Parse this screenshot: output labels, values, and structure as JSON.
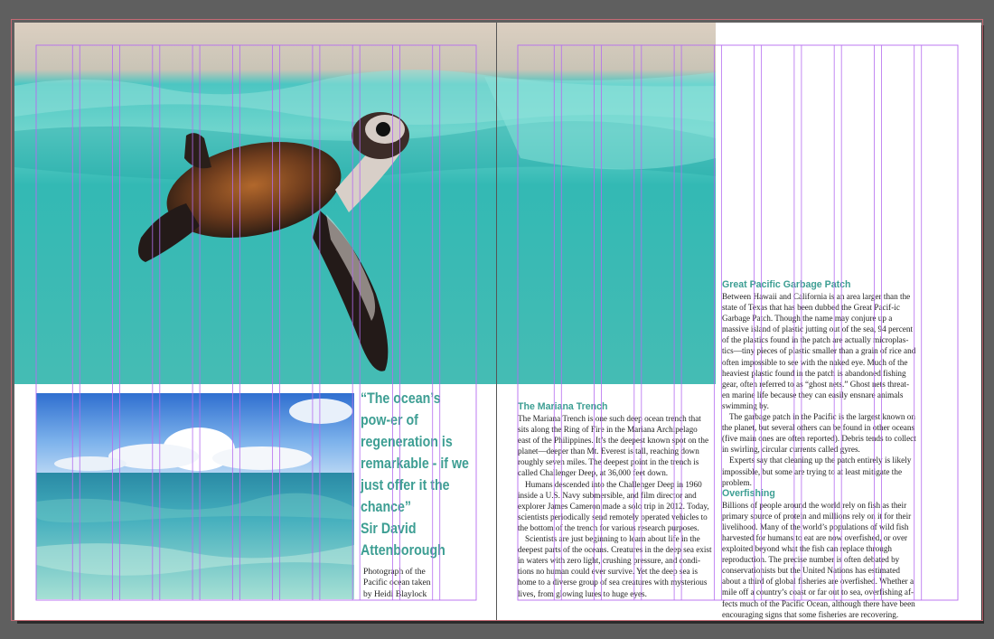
{
  "colors": {
    "accent": "#3d9e93",
    "guide": "#b56cf0",
    "pasteboard": "#5f5f5f",
    "bleed": "#c66a74"
  },
  "images": {
    "turtle": "sea-turtle-photo",
    "ocean": "pacific-ocean-photo"
  },
  "quote": {
    "text": "“The ocean’s pow-er of regeneration is remarkable - if we just offer it the chance”",
    "attribution": "Sir David Attenborough"
  },
  "caption": {
    "lines": [
      "Photograph of the",
      "Pacific ocean taken",
      "by Heidi Blaylock"
    ]
  },
  "mariana": {
    "heading": "The Mariana Trench",
    "paragraphs": [
      "The Mariana Trench is one such deep ocean trench that sits along the Ring of Fire in the Mariana Archipelago east of the Philippines. It’s the deepest known spot on the planet—deeper than Mt. Everest is tall, reaching down roughly seven miles. The deepest point in the trench is called Challenger Deep, at 36,000 feet down.",
      "Humans descended into the Challenger Deep in 1960 inside a U.S. Navy submersible, and film director and explorer James Cameron made a solo trip in 2012. Today, scientists periodically send remotely operated vehicles to the bottom of the trench for various research purposes.",
      "Scientists are just beginning to learn about life in the deepest parts of the oceans. Creatures in the deep sea exist in waters with zero light, crushing pressure, and condi-tions no human could ever survive. Yet the deep sea is home to a diverse group of sea creatures with mysterious lives, from glowing lures to huge eyes."
    ]
  },
  "garbage": {
    "heading": "Great Pacific Garbage Patch",
    "paragraphs": [
      "Between Hawaii and California is an area larger than the state of Texas that has been dubbed the Great Pacif-ic Garbage Patch. Though the name may conjure up a massive island of plastic jutting out of the sea, 94 percent of the plastics found in the patch are actually microplas-tics—tiny pieces of plastic smaller than a grain of rice and often impossible to see with the naked eye. Much of the heaviest plastic found in the patch is abandoned fishing gear, often referred to as “ghost nets.” Ghost nets threat-en marine life because they can easily ensnare animals swimming by.",
      "The garbage patch in the Pacific is the largest known on the planet, but several others can be found in other oceans (five main ones are often reported). Debris tends to collect in swirling, circular currents called gyres.",
      "Experts say that cleaning up the patch entirely is likely impossible, but some are trying to at least mitigate the problem."
    ]
  },
  "overfishing": {
    "heading": "Overfishing",
    "paragraphs": [
      "Billions of people around the world rely on fish as their primary source of protein and millions rely on it for their livelihood. Many of the world’s populations of wild fish harvested for humans to eat are now overfished, or over exploited beyond what the fish can replace through reproduction. The precise number is often debated by conservationists but the United Nations has estimated about a third of global fisheries are overfished. Whether a mile off a country’s coast or far out to sea, overfishing af-fects much of the Pacific Ocean, although there have been encouraging signs that some fisheries are recovering."
    ]
  }
}
